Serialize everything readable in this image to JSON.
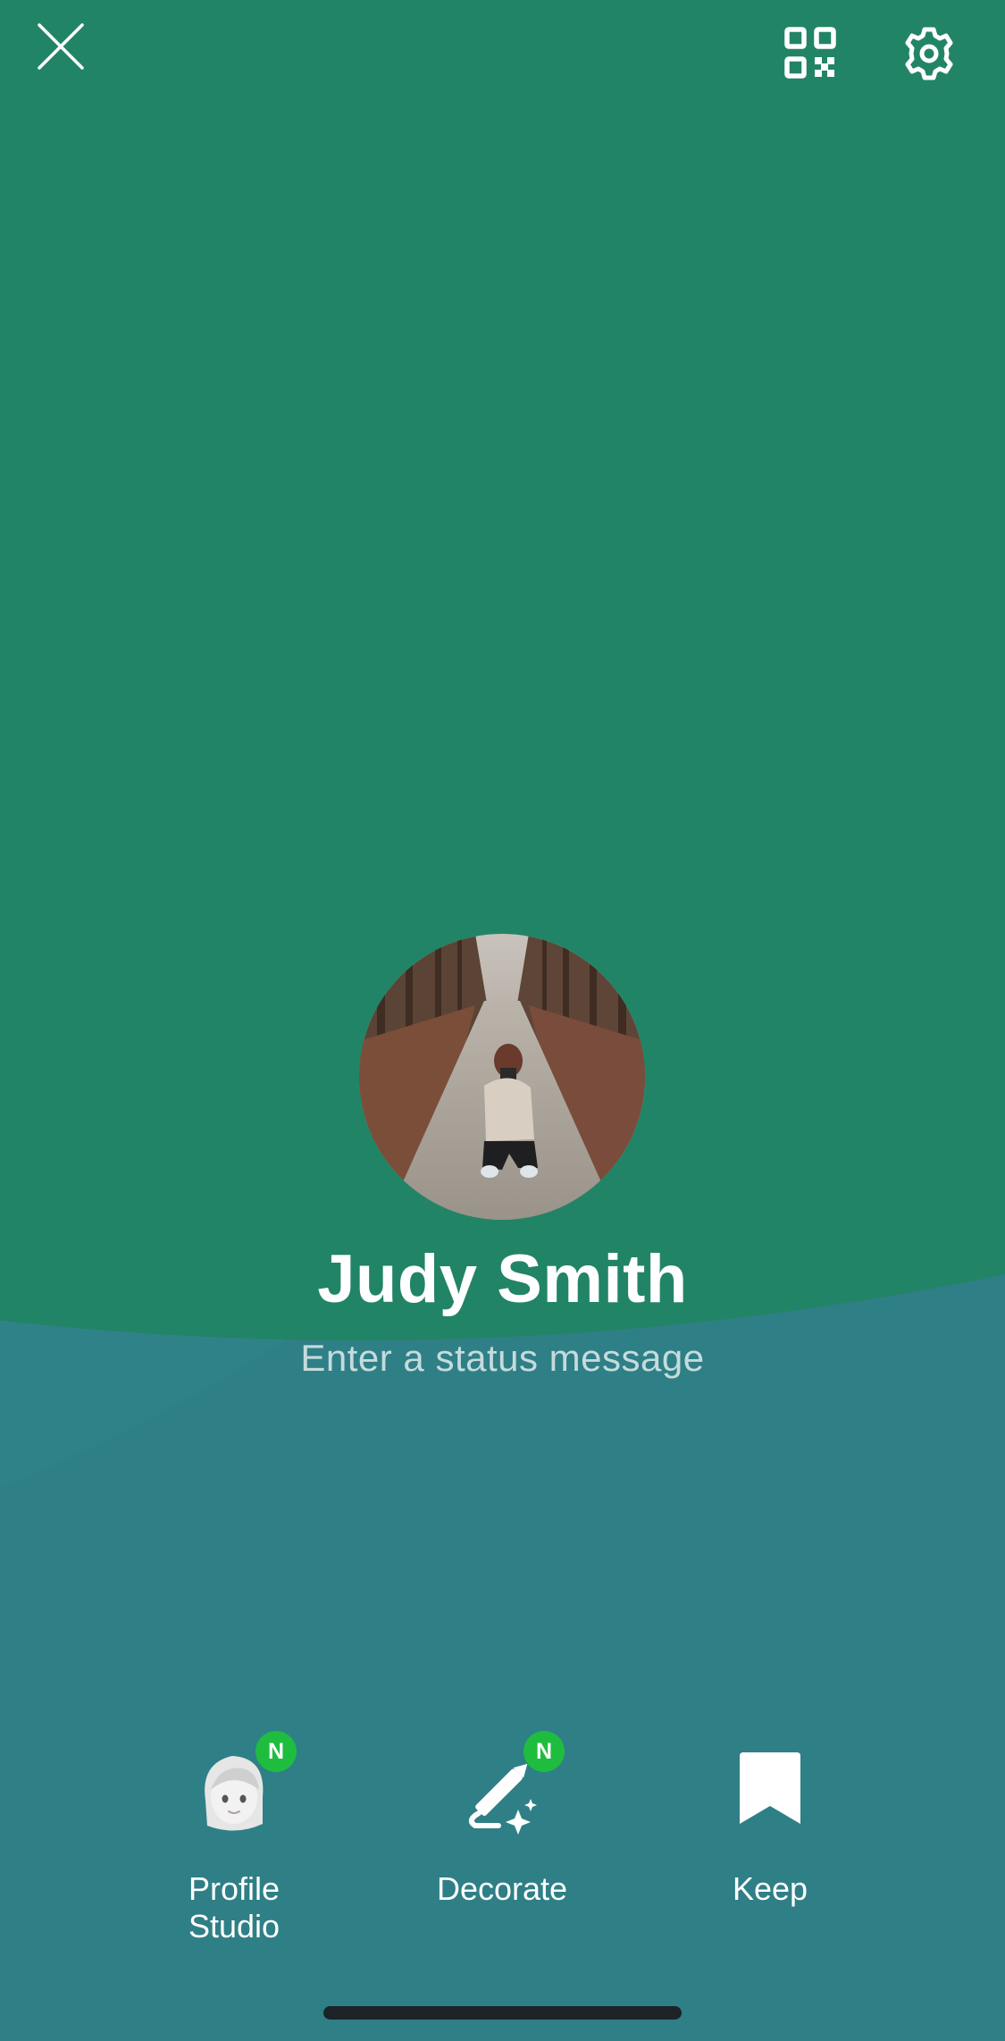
{
  "profile": {
    "name": "Judy Smith",
    "status_placeholder": "Enter a status message"
  },
  "topbar": {
    "close_icon": "close-icon",
    "qr_icon": "qr-code-icon",
    "settings_icon": "gear-icon"
  },
  "actions": [
    {
      "label": "Profile\nStudio",
      "icon": "profile-studio-avatar-icon",
      "badge": "N"
    },
    {
      "label": "Decorate",
      "icon": "decorate-pen-icon",
      "badge": "N"
    },
    {
      "label": "Keep",
      "icon": "bookmark-icon"
    }
  ],
  "colors": {
    "background_top": "#228466",
    "background_bottom": "#2f7f86",
    "badge": "#1fbd3f",
    "text": "#ffffff"
  }
}
